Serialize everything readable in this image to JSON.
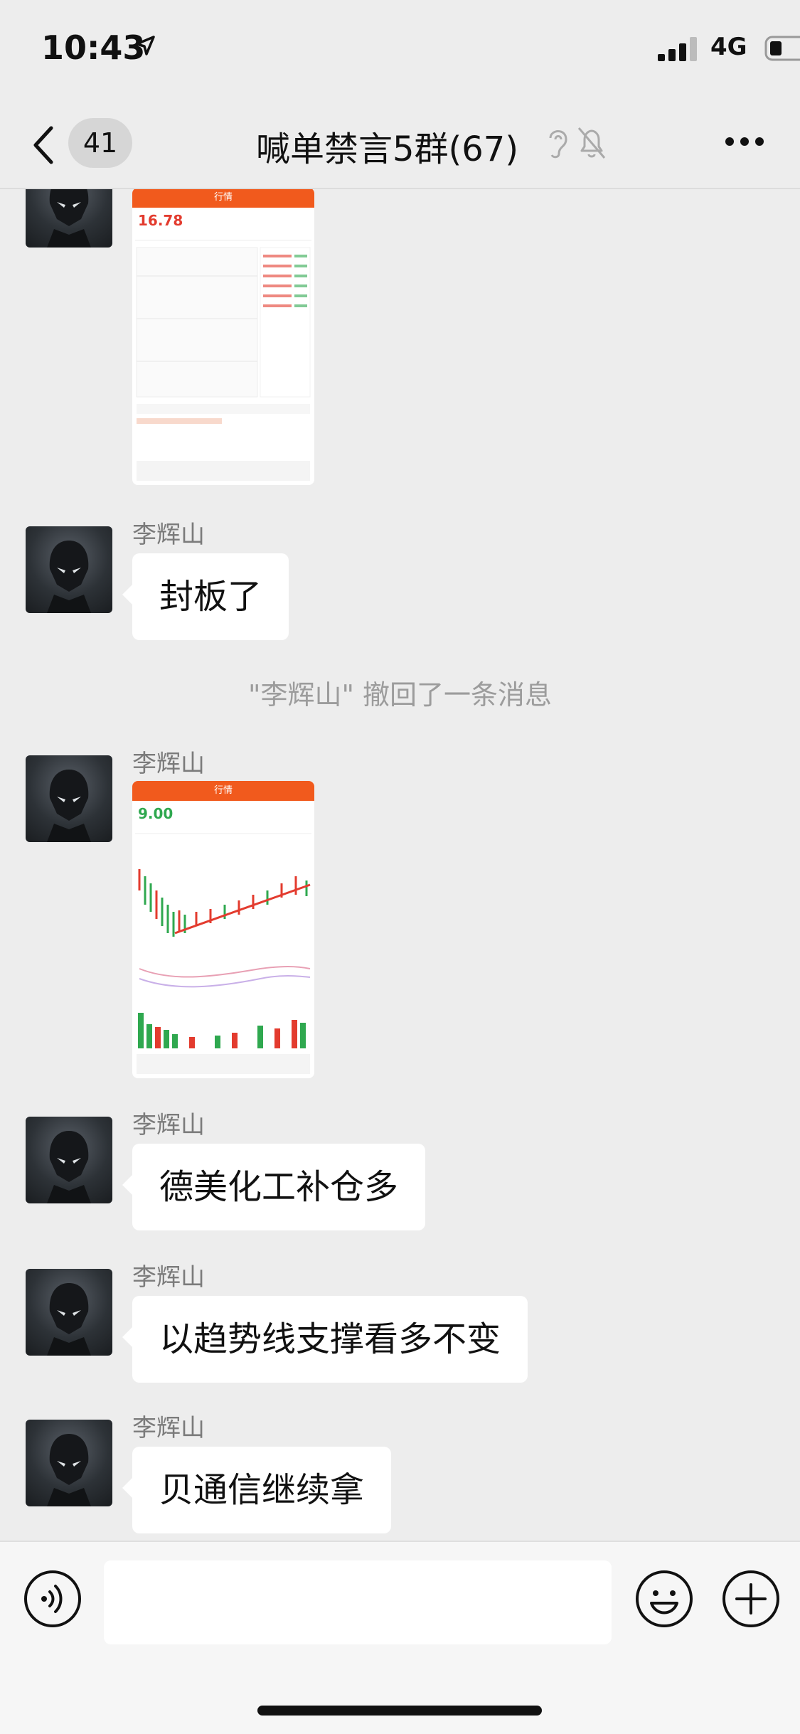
{
  "status_bar": {
    "time": "10:43",
    "network": "4G"
  },
  "nav": {
    "unread_count": "41",
    "title": "喊单禁言5群(67)"
  },
  "messages": [
    {
      "type": "image",
      "price": "16.78"
    },
    {
      "type": "text",
      "sender": "李辉山",
      "text": "封板了"
    },
    {
      "type": "system",
      "text": "\"李辉山\" 撤回了一条消息"
    },
    {
      "type": "image",
      "sender": "李辉山",
      "price": "9.00"
    },
    {
      "type": "text",
      "sender": "李辉山",
      "text": "德美化工补仓多"
    },
    {
      "type": "text",
      "sender": "李辉山",
      "text": "以趋势线支撑看多不变"
    },
    {
      "type": "text",
      "sender": "李辉山",
      "text": "贝通信继续拿"
    }
  ],
  "input": {
    "placeholder": ""
  },
  "colors": {
    "background": "#ededed",
    "bubble": "#ffffff",
    "accent_orange": "#f15a1d",
    "up_red": "#e33b2e",
    "down_green": "#2fa84f"
  }
}
